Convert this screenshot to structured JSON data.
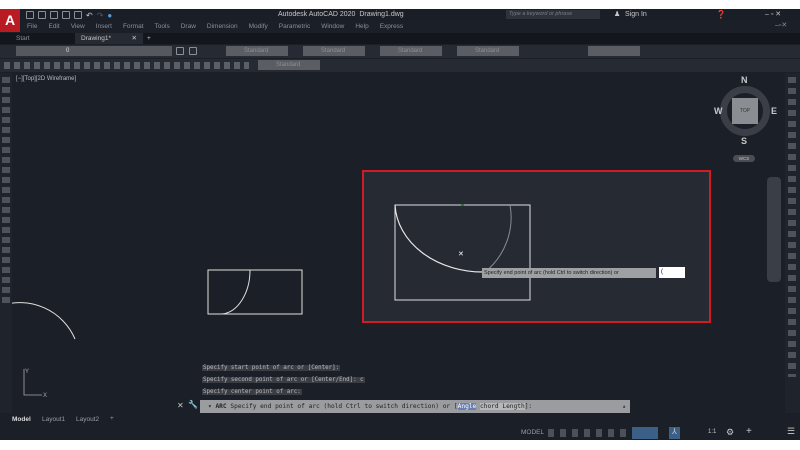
{
  "title": {
    "app": "Autodesk AutoCAD 2020",
    "doc": "Drawing1.dwg",
    "search_placeholder": "Type a keyword or phrase",
    "sign_in": "Sign In",
    "logo": "A"
  },
  "menu": [
    "File",
    "Edit",
    "View",
    "Insert",
    "Format",
    "Tools",
    "Draw",
    "Dimension",
    "Modify",
    "Parametric",
    "Window",
    "Help",
    "Express"
  ],
  "tabs": [
    {
      "label": "Start"
    },
    {
      "label": "Drawing1*"
    }
  ],
  "toolbar": {
    "layer_value": "0",
    "text_style": "Standard",
    "dim_style": "Standard",
    "table_style": "Standard",
    "mleader_style": "Standard",
    "style5": "Standard"
  },
  "viewport": {
    "label": "[−][Top][2D Wireframe]"
  },
  "viewcube": {
    "n": "N",
    "s": "S",
    "e": "E",
    "w": "W",
    "face": "TOP",
    "wcs": "WCS"
  },
  "tooltip": {
    "text": "Specify end point of arc (hold Ctrl to switch direction) or",
    "input": "("
  },
  "command": {
    "history": [
      "Specify start point of arc or [Center]:",
      "Specify second point of arc or [Center/End]: c",
      "Specify center point of arc:"
    ],
    "prefix": "ARC",
    "prompt": "Specify end point of arc (hold Ctrl to switch direction) or [",
    "opt1": "Angle",
    "opt2": "chord Length",
    "suffix": "]:"
  },
  "layouts": [
    "Model",
    "Layout1",
    "Layout2"
  ],
  "status": {
    "model": "MODEL",
    "scale": "1:1"
  },
  "colors": {
    "highlight": "#d01c25",
    "accent": "#3c82c8"
  }
}
